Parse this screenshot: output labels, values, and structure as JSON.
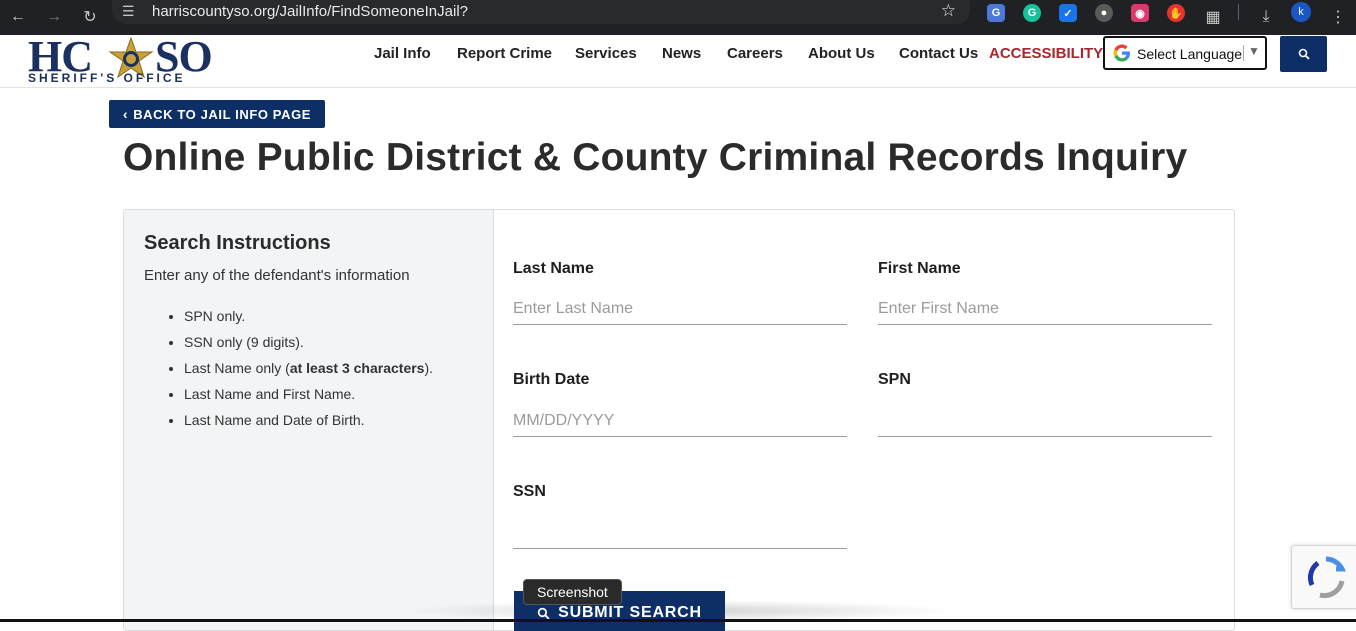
{
  "browser": {
    "url": "harriscountyso.org/JailInfo/FindSomeoneInJail?",
    "profile_initial": "k"
  },
  "site": {
    "logo_left": "HC",
    "logo_right": "SO",
    "logo_sub": "SHERIFF'S OFFICE",
    "nav": [
      "Jail Info",
      "Report Crime",
      "Services",
      "News",
      "Careers",
      "About Us",
      "Contact Us"
    ],
    "accessibility": "ACCESSIBILITY",
    "language_label": "Select Language",
    "language_arrow": "▼"
  },
  "main": {
    "back_label": "BACK TO JAIL INFO PAGE",
    "title": "Online Public District & County Criminal Records Inquiry",
    "instructions": {
      "heading": "Search Instructions",
      "intro": "Enter any of the defendant's information",
      "items": [
        "SPN only.",
        "SSN only (9 digits).",
        "Last Name only (",
        "at least 3 characters",
        ").",
        "Last Name and First Name.",
        "Last Name and Date of Birth."
      ]
    },
    "form": {
      "last_name_label": "Last Name",
      "last_name_placeholder": "Enter Last Name",
      "first_name_label": "First Name",
      "first_name_placeholder": "Enter First Name",
      "birth_date_label": "Birth Date",
      "birth_date_placeholder": "MM/DD/YYYY",
      "spn_label": "SPN",
      "ssn_label": "SSN",
      "submit_label": "SUBMIT SEARCH"
    },
    "tooltip": "Screenshot"
  },
  "colors": {
    "navy": "#0d2f66",
    "accessibility_red": "#a8262c",
    "logo_navy": "#1a3060",
    "logo_gold": "#c9a13a"
  }
}
